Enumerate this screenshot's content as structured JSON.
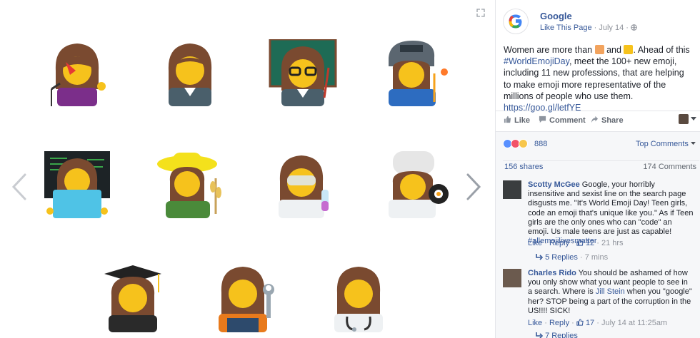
{
  "post": {
    "page_name": "Google",
    "like_page": "Like This Page",
    "date_sep": "·",
    "date": "July 14",
    "date_sep2": "·",
    "text_before": "Women are more than",
    "text_and": "and",
    "text_after": ". Ahead of this",
    "hashtag": "#WorldEmojiDay",
    "text_rest": ", meet the 100+ new emoji, including 11 new professions, that are helping to make emoji more representative of the millions of people who use them.",
    "link": "https://goo.gl/letfYE"
  },
  "actions": {
    "like": "Like",
    "comment": "Comment",
    "share": "Share"
  },
  "reactions": {
    "count": "888",
    "top_comments": "Top Comments",
    "shares": "156 shares",
    "comments": "174 Comments"
  },
  "comments": [
    {
      "author": "Scotty McGee",
      "text": " Google, your horribly insensitive and sexist line on the search page disgusts me. \"It's World Emoji Day! Teen girls, code an emoji that's unique like you.\" As if Teen girls are the only ones who can \"code\" an emoji. Us male teens are just as capable! ",
      "hashtag": "#allemojilivesmatter",
      "like": "Like",
      "sep1": " · ",
      "reply": "Reply",
      "sep2": " · ",
      "likes": "12",
      "sep3": " · ",
      "time": "21 hrs",
      "replies": "5 Replies",
      "replies_sep": " · ",
      "replies_time": "7 mins"
    },
    {
      "author": "Charles Rido",
      "text_a": " You should be ashamed of how you only show what you want people to see in a search. Where is ",
      "mention": "Jill Stein",
      "text_b": " when you \"google\" her? STOP being a part of the corruption in the US!!!! SICK!",
      "like": "Like",
      "sep1": " · ",
      "reply": "Reply",
      "sep2": " · ",
      "likes": "17",
      "sep3": " · ",
      "time": "July 14 at 11:25am",
      "replies": "7 Replies"
    }
  ],
  "icons": {
    "expand": "expand-icon",
    "prev": "chevron-left-icon",
    "next": "chevron-right-icon",
    "globe": "globe-icon",
    "like": "thumbs-up-icon",
    "comment": "comment-icon",
    "share": "share-icon"
  },
  "emoji": [
    "woman-singer-emoji",
    "woman-office-worker-emoji",
    "woman-teacher-emoji",
    "woman-welder-emoji",
    "woman-technologist-emoji",
    "woman-farmer-emoji",
    "woman-scientist-emoji",
    "woman-cook-emoji",
    "woman-student-emoji",
    "woman-mechanic-emoji",
    "woman-health-worker-emoji"
  ],
  "colors": {
    "link": "#365899",
    "muted": "#90949c",
    "skin": "#f6c21c",
    "hair": "#7a4a30"
  }
}
